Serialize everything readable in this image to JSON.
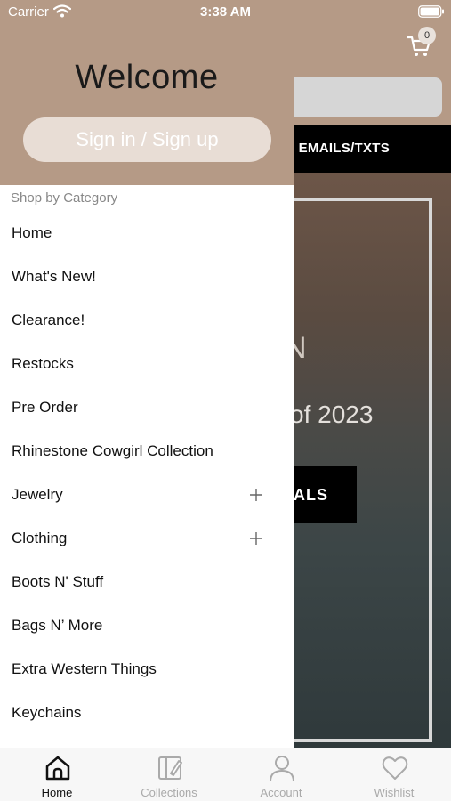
{
  "status_bar": {
    "carrier": "Carrier",
    "time": "3:38 AM"
  },
  "background": {
    "cart_count": "0",
    "announcement": "R EMAILS/TXTS",
    "hero_letter": "N",
    "hero_subtitle": "of 2023",
    "hero_button": "ALS"
  },
  "drawer": {
    "welcome": "Welcome",
    "signin_label": "Sign in / Sign up",
    "section_title": "Shop by Category",
    "categories": [
      {
        "label": "Home",
        "expandable": false
      },
      {
        "label": "What's New!",
        "expandable": false
      },
      {
        "label": "Clearance!",
        "expandable": false
      },
      {
        "label": "Restocks",
        "expandable": false
      },
      {
        "label": "Pre Order",
        "expandable": false
      },
      {
        "label": "Rhinestone Cowgirl Collection",
        "expandable": false
      },
      {
        "label": "Jewelry",
        "expandable": true
      },
      {
        "label": "Clothing",
        "expandable": true
      },
      {
        "label": "Boots N' Stuff",
        "expandable": false
      },
      {
        "label": "Bags N’ More",
        "expandable": false
      },
      {
        "label": "Extra Western Things",
        "expandable": false
      },
      {
        "label": "Keychains",
        "expandable": false
      }
    ]
  },
  "tab_bar": {
    "tabs": [
      {
        "label": "Home",
        "icon": "home-icon",
        "active": true
      },
      {
        "label": "Collections",
        "icon": "collections-icon",
        "active": false
      },
      {
        "label": "Account",
        "icon": "account-icon",
        "active": false
      },
      {
        "label": "Wishlist",
        "icon": "heart-icon",
        "active": false
      }
    ]
  },
  "colors": {
    "brand": "#b59a86",
    "active_tab": "#111111",
    "inactive_tab": "#aaaaaa"
  }
}
